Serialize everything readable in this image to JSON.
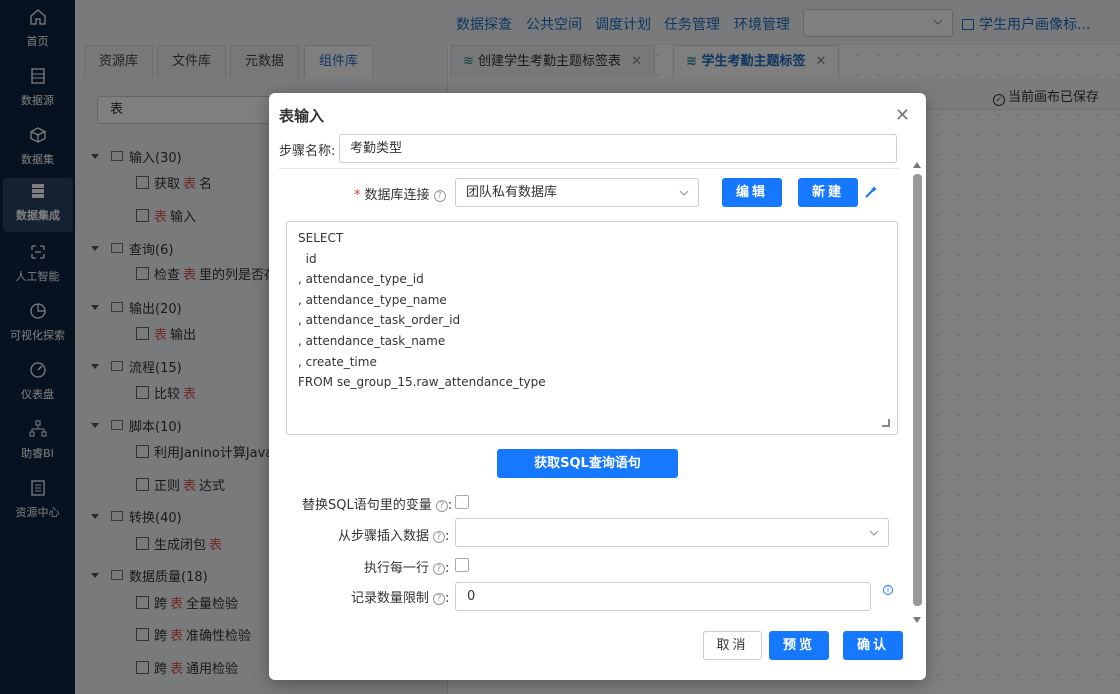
{
  "nav": {
    "items": [
      {
        "label": "首页",
        "icon": "home-icon"
      },
      {
        "label": "数据源",
        "icon": "datasource-icon"
      },
      {
        "label": "数据集",
        "icon": "dataset-icon"
      },
      {
        "label": "数据集成",
        "icon": "integration-icon",
        "active": true
      },
      {
        "label": "人工智能",
        "icon": "ai-icon"
      },
      {
        "label": "可视化探索",
        "icon": "chart-icon"
      },
      {
        "label": "仪表盘",
        "icon": "gauge-icon"
      },
      {
        "label": "助睿BI",
        "icon": "bi-icon"
      },
      {
        "label": "资源中心",
        "icon": "resource-icon"
      }
    ]
  },
  "topbar": {
    "menu": [
      "数据探查",
      "公共空间",
      "调度计划",
      "任务管理",
      "环境管理"
    ],
    "select_value": "",
    "user_link": "学生用户画像标..."
  },
  "left_panel": {
    "tabs": [
      "资源库",
      "文件库",
      "元数据",
      "组件库"
    ],
    "active_tab": "组件库",
    "search_value": "表",
    "tree": {
      "cat_input": "输入(30)",
      "item_get_pre": "获取",
      "item_get_hl": "表",
      "item_get_post": "名",
      "item_input_hl": "表",
      "item_input_post": "输入",
      "cat_query": "查询(6)",
      "item_check_pre": "检查",
      "item_check_hl": "表",
      "item_check_post": "里的列是否存",
      "cat_output": "输出(20)",
      "item_output_hl": "表",
      "item_output_post": "输出",
      "cat_flow": "流程(15)",
      "item_compare_pre": "比较",
      "item_compare_hl": "表",
      "cat_script": "脚本(10)",
      "item_janino": "利用Janino计算Java",
      "item_regex_pre": "正则",
      "item_regex_hl": "表",
      "item_regex_post": "达式",
      "cat_transform": "转换(40)",
      "item_closure_pre": "生成闭包",
      "item_closure_hl": "表",
      "cat_quality": "数据质量(18)",
      "item_q1_pre": "跨",
      "item_q1_hl": "表",
      "item_q1_post": "全量检验",
      "item_q2_pre": "跨",
      "item_q2_hl": "表",
      "item_q2_post": "准确性检验",
      "item_q3_pre": "跨",
      "item_q3_hl": "表",
      "item_q3_post": "通用检验"
    }
  },
  "canvas": {
    "tabs": [
      "创建学生考勤主题标签表",
      "学生考勤主题标签"
    ],
    "active_tab": "学生考勤主题标签",
    "saved_text": "当前画布已保存"
  },
  "dialog": {
    "title": "表输入",
    "step_label": "步骤名称:",
    "step_value": "考勤类型",
    "db_label": "数据库连接",
    "db_value": "团队私有数据库",
    "edit_btn": "编辑",
    "new_btn": "新建",
    "sql": "SELECT\n  id\n, attendance_type_id\n, attendance_type_name\n, attendance_task_order_id\n, attendance_task_name\n, create_time\nFROM se_group_15.raw_attendance_type",
    "get_sql_btn": "获取SQL查询语句",
    "replace_var_label": "替换SQL语句里的变量",
    "insert_from_step_label": "从步骤插入数据",
    "exec_each_row_label": "执行每一行",
    "limit_label": "记录数量限制",
    "limit_value": "0",
    "cancel_btn": "取消",
    "preview_btn": "预览",
    "confirm_btn": "确认"
  }
}
